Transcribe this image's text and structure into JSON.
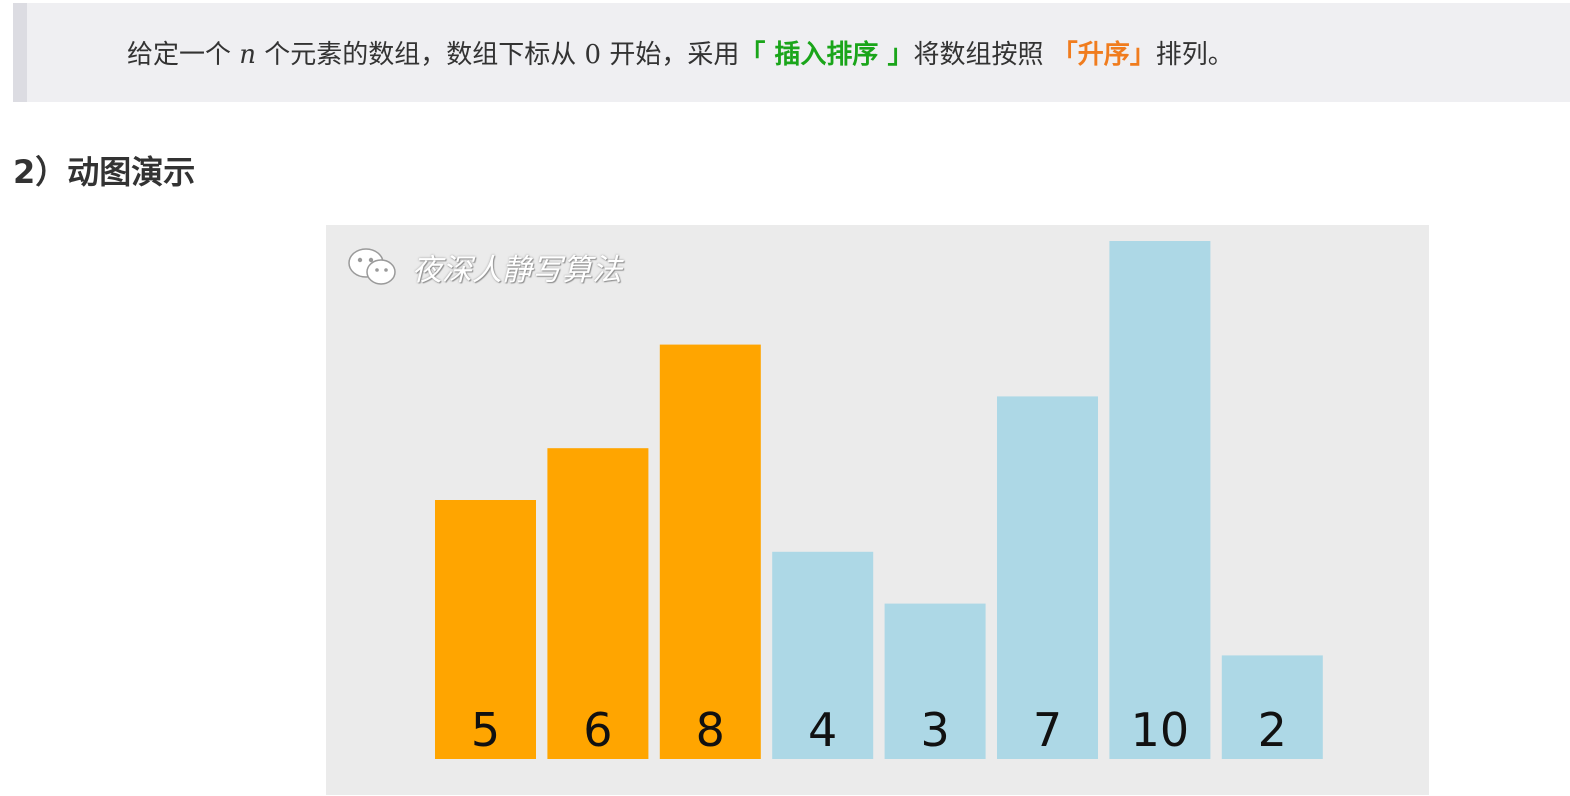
{
  "quote": {
    "text_1": "给定一个 ",
    "var_n": "n",
    "text_2": " 个元素的数组，数组下标从 ",
    "index_zero": "0",
    "text_3": " 开始，采用",
    "algo_highlight": "「 插入排序 」",
    "text_4": "将数组按照 ",
    "order_highlight": "「升序」",
    "text_5": "排列。",
    "highlight_colors": {
      "green": "#1aa51a",
      "orange": "#f07c1e"
    }
  },
  "section": {
    "heading": "2）动图演示"
  },
  "figure": {
    "watermark_text": "夜深人静写算法",
    "watermark_icon": "wechat-icon"
  },
  "chart_data": {
    "type": "bar",
    "title": "",
    "xlabel": "",
    "ylabel": "",
    "values": [
      5,
      6,
      8,
      4,
      3,
      7,
      10,
      2
    ],
    "states": [
      "sorted",
      "sorted",
      "sorted",
      "unsorted",
      "unsorted",
      "unsorted",
      "unsorted",
      "unsorted"
    ],
    "colors": {
      "sorted": "#ffa500",
      "unsorted": "#add8e6"
    },
    "ylim": [
      0,
      10
    ],
    "grid": false,
    "legend": "none"
  }
}
